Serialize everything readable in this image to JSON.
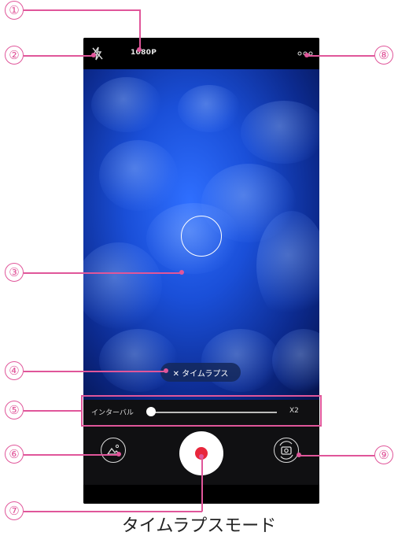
{
  "topbar": {
    "resolution": "1080P",
    "flash_icon": "flash-off-icon",
    "more_icon": "more-icon"
  },
  "viewfinder": {
    "mode_chip": "✕ タイムラプス"
  },
  "interval": {
    "label": "インターバル",
    "multiplier": "X2",
    "slider_value": 0
  },
  "controls": {
    "gallery_icon": "gallery-icon",
    "record_icon": "record-icon",
    "switch_icon": "switch-camera-icon"
  },
  "callouts": [
    "①",
    "②",
    "③",
    "④",
    "⑤",
    "⑥",
    "⑦",
    "⑧",
    "⑨"
  ],
  "caption": "タイムラプスモード",
  "colors": {
    "callout": "#e0569a",
    "record": "#e8263b"
  }
}
